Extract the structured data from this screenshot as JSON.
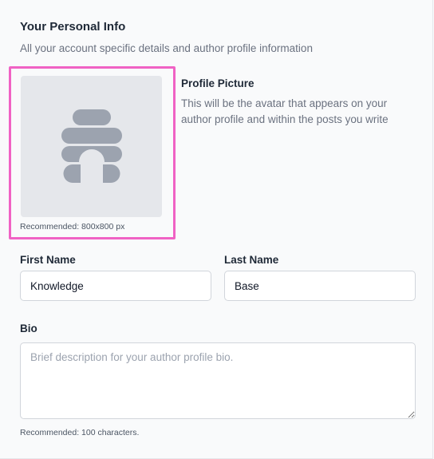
{
  "section": {
    "title": "Your Personal Info",
    "subtitle": "All your account specific details and author profile information"
  },
  "profile_picture": {
    "title": "Profile Picture",
    "description": "This will be the avatar that appears on your author profile and within the posts you write",
    "recommendation": "Recommended: 800x800 px",
    "placeholder_icon": "beehive-placeholder-icon",
    "highlight_color": "#f062c4"
  },
  "first_name": {
    "label": "First Name",
    "value": "Knowledge"
  },
  "last_name": {
    "label": "Last Name",
    "value": "Base"
  },
  "bio": {
    "label": "Bio",
    "placeholder": "Brief description for your author profile bio.",
    "value": "",
    "recommendation": "Recommended: 100 characters."
  }
}
